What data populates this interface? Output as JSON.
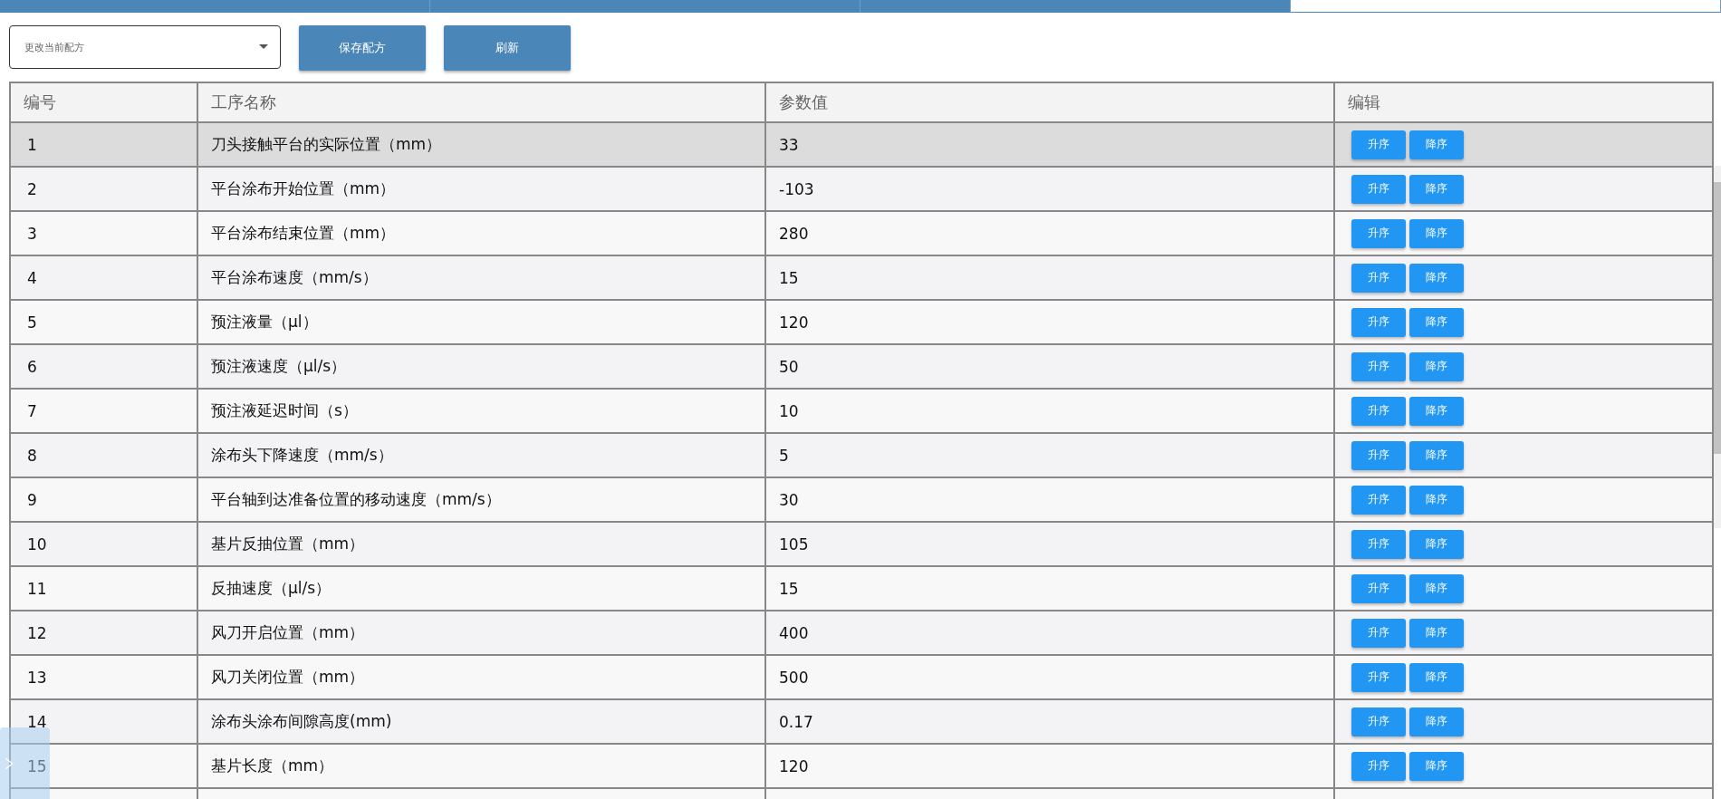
{
  "tabs": [
    {
      "selected": false
    },
    {
      "selected": false
    },
    {
      "selected": false
    },
    {
      "selected": true
    }
  ],
  "toolbar": {
    "recipe_select": {
      "placeholder": "更改当前配方"
    },
    "buttons": [
      "保存配方",
      "刷新"
    ]
  },
  "table": {
    "columns": [
      "编号",
      "工序名称",
      "参数值",
      "编辑"
    ],
    "rows": [
      {
        "no": "1",
        "name": "刀头接触平台的实际位置（mm）",
        "value": "33",
        "selected": true,
        "actions": [
          "升序",
          "降序"
        ]
      },
      {
        "no": "2",
        "name": "平台涂布开始位置（mm）",
        "value": "-103",
        "selected": false,
        "actions": [
          "升序",
          "降序"
        ]
      },
      {
        "no": "3",
        "name": "平台涂布结束位置（mm）",
        "value": "280",
        "selected": false,
        "actions": [
          "升序",
          "降序"
        ]
      },
      {
        "no": "4",
        "name": "平台涂布速度（mm/s）",
        "value": "15",
        "selected": false,
        "actions": [
          "升序",
          "降序"
        ]
      },
      {
        "no": "5",
        "name": "预注液量（μl）",
        "value": "120",
        "selected": false,
        "actions": [
          "升序",
          "降序"
        ]
      },
      {
        "no": "6",
        "name": "预注液速度（μl/s）",
        "value": "50",
        "selected": false,
        "actions": [
          "升序",
          "降序"
        ]
      },
      {
        "no": "7",
        "name": "预注液延迟时间（s）",
        "value": "10",
        "selected": false,
        "actions": [
          "升序",
          "降序"
        ]
      },
      {
        "no": "8",
        "name": "涂布头下降速度（mm/s）",
        "value": "5",
        "selected": false,
        "actions": [
          "升序",
          "降序"
        ]
      },
      {
        "no": "9",
        "name": "平台轴到达准备位置的移动速度（mm/s）",
        "value": "30",
        "selected": false,
        "actions": [
          "升序",
          "降序"
        ]
      },
      {
        "no": "10",
        "name": "基片反抽位置（mm）",
        "value": "105",
        "selected": false,
        "actions": [
          "升序",
          "降序"
        ]
      },
      {
        "no": "11",
        "name": "反抽速度（μl/s）",
        "value": "15",
        "selected": false,
        "actions": [
          "升序",
          "降序"
        ]
      },
      {
        "no": "12",
        "name": "风刀开启位置（mm）",
        "value": "400",
        "selected": false,
        "actions": [
          "升序",
          "降序"
        ]
      },
      {
        "no": "13",
        "name": "风刀关闭位置（mm）",
        "value": "500",
        "selected": false,
        "actions": [
          "升序",
          "降序"
        ]
      },
      {
        "no": "14",
        "name": "涂布头涂布间隙高度(mm)",
        "value": "0.17",
        "selected": false,
        "actions": [
          "升序",
          "降序"
        ]
      },
      {
        "no": "15",
        "name": "基片长度（mm）",
        "value": "120",
        "selected": false,
        "actions": [
          "升序",
          "降序"
        ]
      }
    ]
  }
}
